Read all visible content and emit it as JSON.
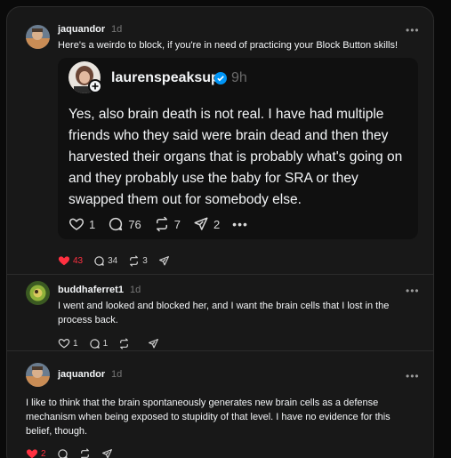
{
  "posts": [
    {
      "username": "jaquandor",
      "time": "1d",
      "text": "Here's a weirdo to block, if you're in need of practicing your Block Button skills!",
      "quote": {
        "username": "laurenspeaksup",
        "time": "9h",
        "text": "Yes, also brain death is not real. I have had multiple friends who they said were brain dead and then they harvested their organs that is probably what's going on and they probably use the baby for SRA or they swapped them out for somebody else.",
        "likes": "1",
        "replies": "76",
        "reposts": "7",
        "shares": "2"
      },
      "likes": "43",
      "replies": "34",
      "reposts": "3"
    },
    {
      "username": "buddhaferret1",
      "time": "1d",
      "text": "I went and looked and blocked her, and I want the brain cells that I lost in the process back.",
      "likes": "1",
      "replies": "1"
    },
    {
      "username": "jaquandor",
      "time": "1d",
      "text": "I like to think that the brain spontaneously generates new brain cells as a defense mechanism when being exposed to stupidity of that level. I have no evidence for this belief, though.",
      "likes": "2"
    }
  ],
  "icons": {
    "more": "more-icon",
    "heart": "heart-icon",
    "reply": "reply-icon",
    "repost": "repost-icon",
    "share": "share-icon",
    "verified": "verified-badge-icon",
    "follow": "follow-plus-icon"
  },
  "colors": {
    "liked": "#ff3040",
    "verified": "#0095f6",
    "background": "#181818"
  }
}
